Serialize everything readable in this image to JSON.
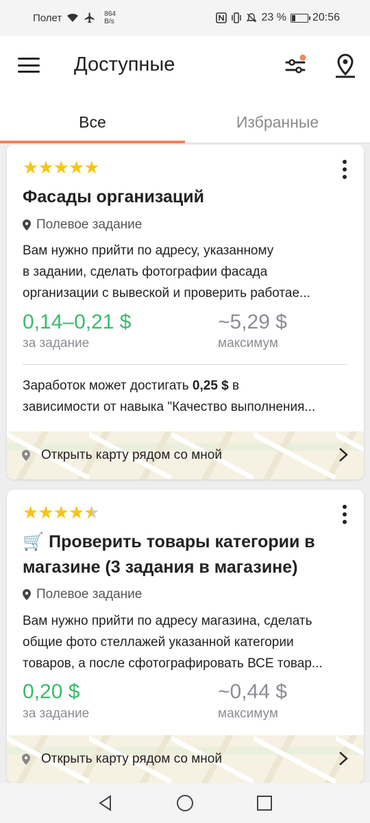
{
  "status_bar": {
    "carrier": "Полет",
    "speed_value": "864",
    "speed_unit": "B/s",
    "battery": "23 %",
    "battery_level": 0.23,
    "time": "20:56"
  },
  "header": {
    "title": "Доступные",
    "icons": [
      "menu-icon",
      "filter-icon",
      "map-pin-icon"
    ]
  },
  "tabs": [
    {
      "label": "Все",
      "active": true
    },
    {
      "label": "Избранные",
      "active": false
    }
  ],
  "cards": [
    {
      "rating": 5,
      "title": "Фасады организаций",
      "type": "Полевое задание",
      "description_lines": [
        "Вам нужно прийти по адресу, указанному",
        "в задании, сделать фотографии фасада",
        "организации с вывеской и проверить работае..."
      ],
      "price": "0,14–0,21 $",
      "price_label": "за задание",
      "max": "~5,29 $",
      "max_label": "максимум",
      "note_prefix": "Заработок может достигать ",
      "note_bold": "0,25 $",
      "note_suffix": " в",
      "note_line2": "зависимости от навыка \"Качество выполнения...",
      "map_link": "Открыть карту рядом со мной"
    },
    {
      "rating": 4.5,
      "title_emoji": "🛒",
      "title_line1": "Проверить товары категории в",
      "title_line2": "магазине (3 задания в магазине)",
      "type": "Полевое задание",
      "description_lines": [
        "Вам нужно прийти по адресу магазина, сделать",
        "общие фото стеллажей указанной категории",
        "товаров, а после сфотографировать ВСЕ товар..."
      ],
      "price": "0,20 $",
      "price_label": "за задание",
      "max": "~0,44 $",
      "max_label": "максимум",
      "map_link": "Открыть карту рядом со мной"
    }
  ],
  "colors": {
    "accent": "#f0855e",
    "price_green": "#3cb96b",
    "star": "#f5c518",
    "muted": "#8a8d95"
  }
}
